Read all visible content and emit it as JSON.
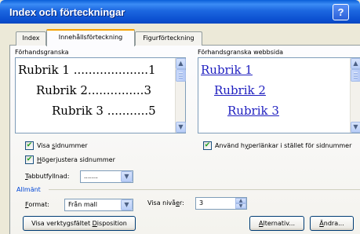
{
  "window": {
    "title": "Index och förteckningar",
    "help_glyph": "?"
  },
  "tabs": [
    {
      "label": "Index",
      "active": false
    },
    {
      "label": "Innehållsförteckning",
      "active": true
    },
    {
      "label": "Figurförteckning",
      "active": false
    }
  ],
  "print_preview": {
    "label": "Förhandsgranska",
    "entries": [
      {
        "text": "Rubrik 1 ....................1"
      },
      {
        "text": "Rubrik 2...............3"
      },
      {
        "text": "Rubrik 3 ...........5"
      }
    ]
  },
  "web_preview": {
    "label": "Förhandsgranska webbsida",
    "entries": [
      {
        "text": "Rubrik 1"
      },
      {
        "text": "Rubrik 2"
      },
      {
        "text": "Rubrik 3"
      }
    ]
  },
  "options": {
    "show_page_numbers": {
      "label": "Visa sidnummer",
      "checked": true
    },
    "right_align": {
      "label": "Högerjustera sidnummer",
      "checked": true
    },
    "tab_leader": {
      "label": "Tabbutfyllnad:",
      "value": "......."
    },
    "use_hyperlinks": {
      "label": "Använd hyperlänkar i stället för sidnummer",
      "checked": true
    }
  },
  "general": {
    "section_label": "Allmänt",
    "format_label": "Format:",
    "format_value": "Från mall",
    "levels_label": "Visa nivåer:",
    "levels_value": "3"
  },
  "buttons": {
    "outline_toolbar": "Visa verktygsfältet Disposition",
    "options": "Alternativ...",
    "modify": "Ändra..."
  },
  "colors": {
    "accent_tab": "#f5a100",
    "section_blue": "#0046d5",
    "link": "#2020c0",
    "check": "#21a121"
  }
}
